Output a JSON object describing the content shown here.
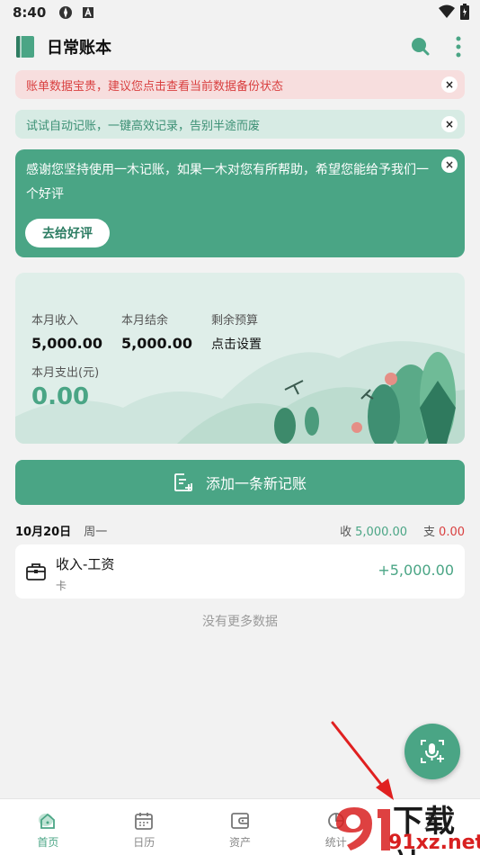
{
  "status_bar": {
    "time": "8:40"
  },
  "app_bar": {
    "title": "日常账本"
  },
  "notices": {
    "backup": "账单数据宝贵，建议您点击查看当前数据备份状态",
    "auto": "试试自动记账，一键高效记录，告别半途而废",
    "close_glyph": "×"
  },
  "review": {
    "text": "感谢您坚持使用一木记账，如果一木对您有所帮助，希望您能给予我们一个好评",
    "button": "去给好评",
    "close_glyph": "×"
  },
  "summary": {
    "month_income_label": "本月收入",
    "month_income_value": "5,000.00",
    "month_balance_label": "本月结余",
    "month_balance_value": "5,000.00",
    "budget_label": "剩余预算",
    "budget_value": "点击设置",
    "month_expense_label": "本月支出(元)",
    "month_expense_value": "0.00"
  },
  "add_button": {
    "label": "添加一条新记账"
  },
  "day": {
    "date": "10月20日",
    "weekday": "周一",
    "income_label": "收",
    "income_value": "5,000.00",
    "expense_label": "支",
    "expense_value": "0.00"
  },
  "record": {
    "category": "收入-工资",
    "account": "卡",
    "amount": "+5,000.00"
  },
  "no_more": "没有更多数据",
  "nav": {
    "home": "首页",
    "calendar": "日历",
    "assets": "资产",
    "stats": "统计"
  },
  "watermark": {
    "line1": "下载站",
    "line2": "91xz.net"
  },
  "colors": {
    "accent": "#4aa585",
    "expense": "#d94040"
  }
}
